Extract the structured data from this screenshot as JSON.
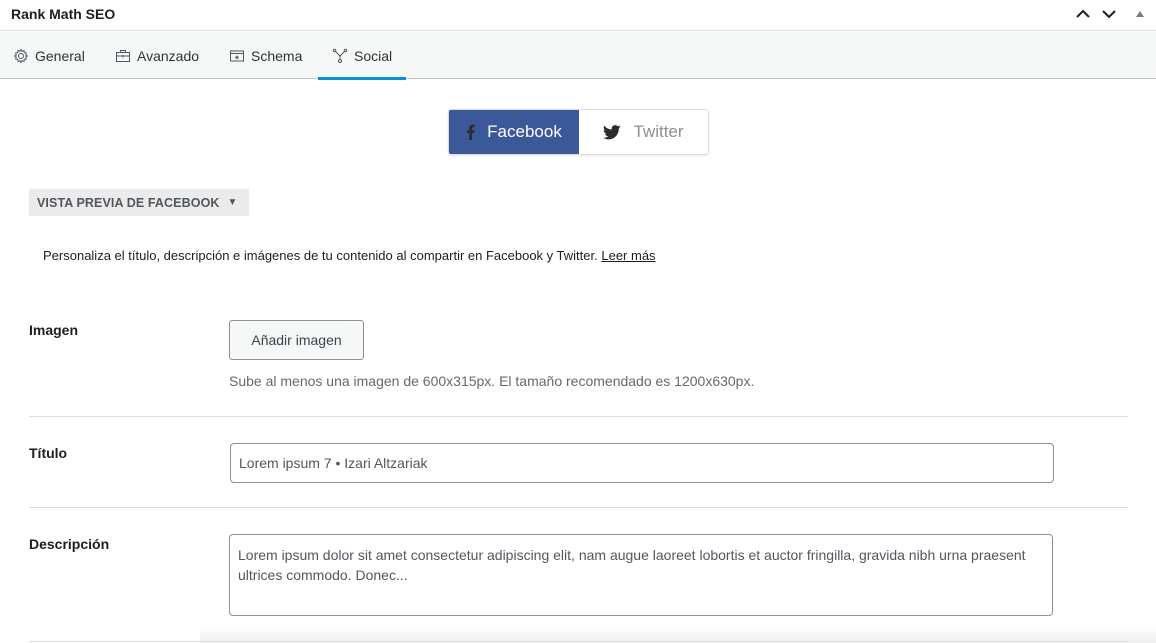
{
  "panel": {
    "title": "Rank Math SEO",
    "controls": [
      "move-up-icon",
      "move-down-icon",
      "collapse-icon"
    ]
  },
  "tabs": [
    {
      "label": "General",
      "icon": "gear-icon",
      "active": false
    },
    {
      "label": "Avanzado",
      "icon": "briefcase-icon",
      "active": false
    },
    {
      "label": "Schema",
      "icon": "schema-icon",
      "active": false
    },
    {
      "label": "Social",
      "icon": "social-network-icon",
      "active": true
    }
  ],
  "social_toggle": {
    "facebook": {
      "label": "Facebook",
      "icon": "facebook-icon",
      "active": true
    },
    "twitter": {
      "label": "Twitter",
      "icon": "twitter-icon",
      "active": false
    }
  },
  "preview": {
    "label": "VISTA PREVIA DE FACEBOOK",
    "caret": "▼"
  },
  "intro": {
    "text": "Personaliza el título, descripción e imágenes de tu contenido al compartir en Facebook y Twitter.",
    "link_label": "Leer más"
  },
  "fields": {
    "image": {
      "label": "Imagen",
      "button_label": "Añadir imagen",
      "hint": "Sube al menos una imagen de 600x315px. El tamaño recomendado es 1200x630px."
    },
    "title": {
      "label": "Título",
      "value": "Lorem ipsum 7 • Izari Altzariak"
    },
    "description": {
      "label": "Descripción",
      "value": "Lorem ipsum dolor sit amet consectetur adipiscing elit, nam augue laoreet lobortis et auctor fringilla, gravida nibh urna praesent ultrices commodo. Donec..."
    }
  },
  "colors": {
    "facebook_brand": "#3b5998",
    "active_tab_underline": "#0d8fd8"
  }
}
